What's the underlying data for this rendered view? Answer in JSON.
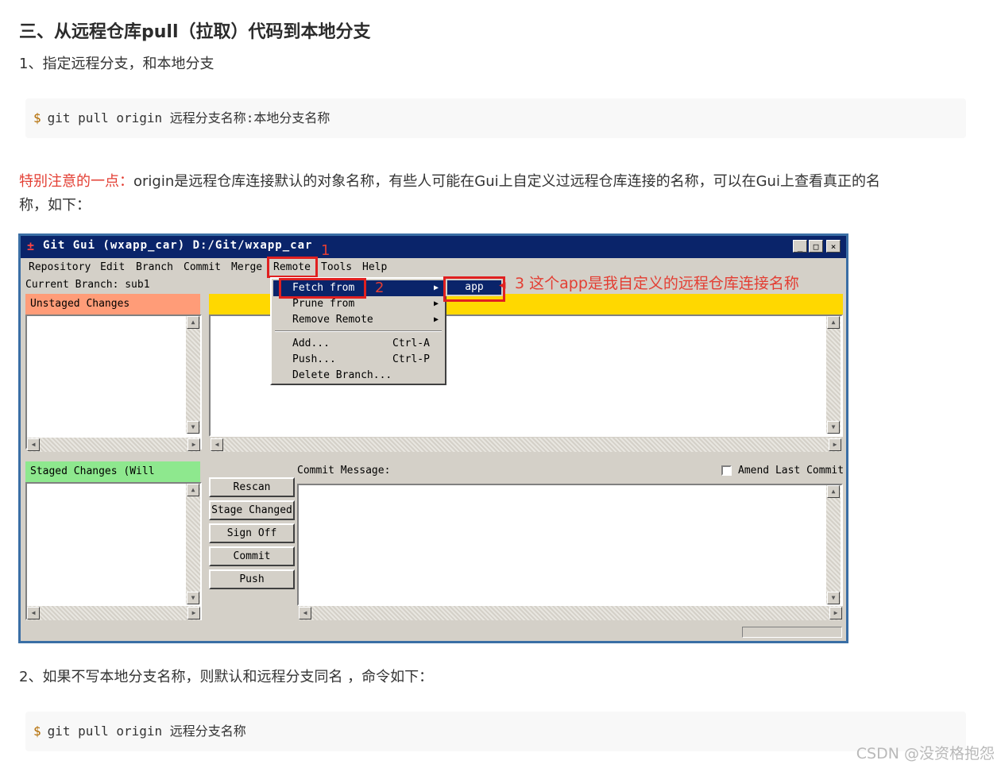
{
  "section_title": "三、从远程仓库pull（拉取）代码到本地分支",
  "step1": "1、指定远程分支，和本地分支",
  "code1": {
    "prompt": "$",
    "command": "git pull origin 远程分支名称:本地分支名称"
  },
  "note": {
    "highlight": "特别注意的一点：",
    "line1": "origin是远程仓库连接默认的对象名称，有些人可能在Gui上自定义过远程仓库连接的名称，可以在Gui上查看真正的名",
    "line2": "称，如下："
  },
  "git_gui": {
    "title": "Git Gui (wxapp_car) D:/Git/wxapp_car",
    "title_buttons": [
      "_",
      "□",
      "×"
    ],
    "menu": [
      "Repository",
      "Edit",
      "Branch",
      "Commit",
      "Merge",
      "Remote",
      "Tools",
      "Help"
    ],
    "current_branch": "Current Branch: sub1",
    "unstaged_header": "Unstaged Changes",
    "staged_header": "Staged Changes (Will Commit)",
    "commit_message_label": "Commit Message:",
    "amend_label": "Amend Last Commit",
    "buttons": [
      "Rescan",
      "Stage Changed",
      "Sign Off",
      "Commit",
      "Push"
    ],
    "remote_menu": [
      {
        "label": "Fetch from",
        "shortcut": "",
        "has_submenu": true
      },
      {
        "label": "Prune from",
        "shortcut": "",
        "has_submenu": true
      },
      {
        "label": "Remove Remote",
        "shortcut": "",
        "has_submenu": true
      },
      {
        "label": "Add...",
        "shortcut": "Ctrl-A",
        "has_submenu": false
      },
      {
        "label": "Push...",
        "shortcut": "Ctrl-P",
        "has_submenu": false
      },
      {
        "label": "Delete Branch...",
        "shortcut": "",
        "has_submenu": false
      }
    ],
    "submenu_item": "app",
    "annotations": {
      "n1": "1",
      "n2": "2",
      "text3": "3 这个app是我自定义的远程仓库连接名称"
    },
    "colors": {
      "unstaged": "#ff9c78",
      "staged": "#8ee88e",
      "diff_header": "#ffd800",
      "titlebar": "#0a246a"
    }
  },
  "step2": "2、如果不写本地分支名称，则默认和远程分支同名 ，命令如下：",
  "code2": {
    "prompt": "$",
    "command": "git pull origin 远程分支名称"
  },
  "watermark": "CSDN @没资格抱怨"
}
